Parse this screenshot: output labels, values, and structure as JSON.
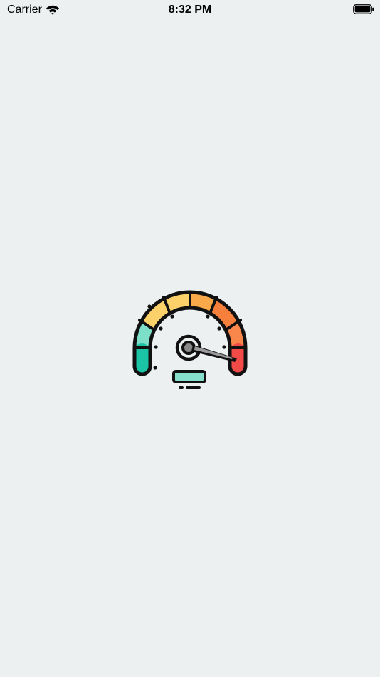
{
  "status_bar": {
    "carrier": "Carrier",
    "time": "8:32 PM",
    "battery_level": 1.0
  },
  "splash": {
    "icon": "speedometer-icon",
    "colors": {
      "background": "#ecf0f1",
      "outline": "#111111",
      "teal": "#1cc4a6",
      "mint": "#7edfc9",
      "yellow": "#fcd16a",
      "orange": "#f9a94a",
      "orange_dark": "#f57f3b",
      "red": "#f24b47",
      "badge_fill": "#86dfca"
    }
  }
}
